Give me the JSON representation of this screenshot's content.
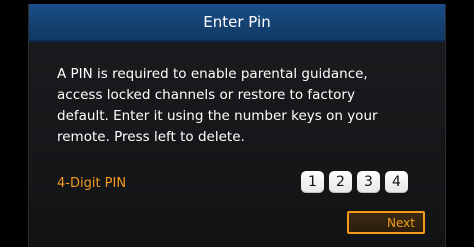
{
  "dialog": {
    "title": "Enter Pin",
    "message_lines": [
      "A PIN is required to enable parental guidance,",
      "access locked channels or restore to factory",
      "default. Enter it using the number keys on your",
      "remote. Press left to delete."
    ],
    "pin_label": "4-Digit PIN",
    "pin_digits": [
      "1",
      "2",
      "3",
      "4"
    ],
    "next_label": "Next"
  },
  "colors": {
    "title_bar": "#154273",
    "accent": "#f29a1d",
    "background": "#141517",
    "digit_box": "#ffffff"
  }
}
